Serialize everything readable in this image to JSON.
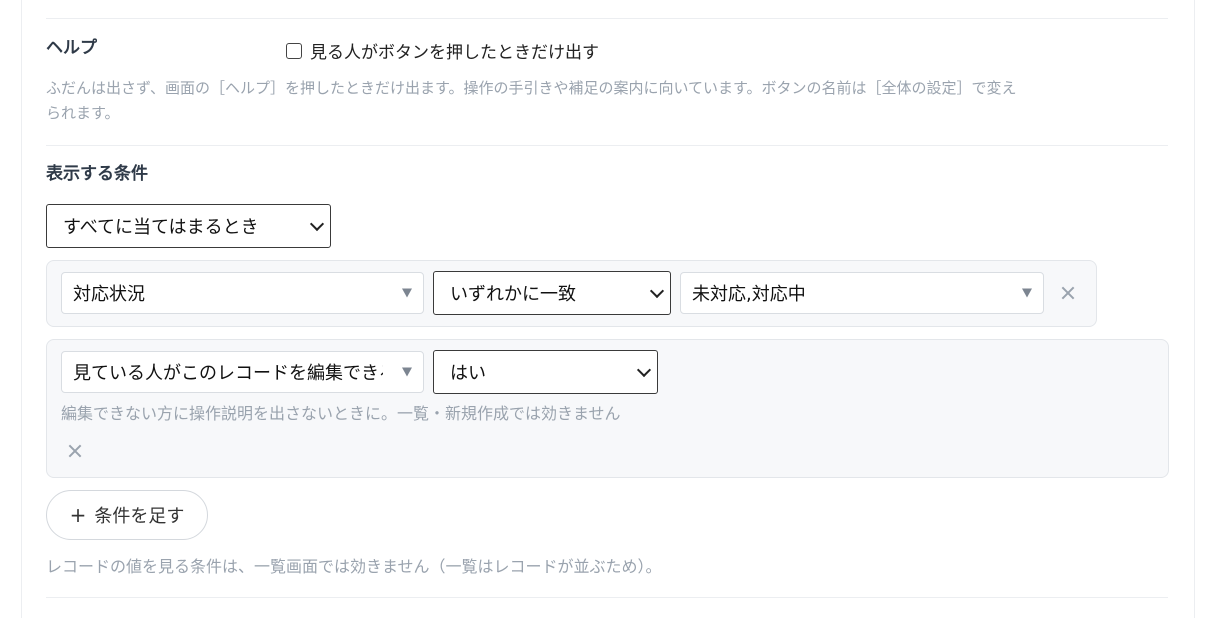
{
  "help": {
    "label": "ヘルプ",
    "checkbox_label": "見る人がボタンを押したときだけ出す",
    "checked": false,
    "description_line1": "ふだんは出さず、画面の［ヘルプ］を押したときだけ出ます。操作の手引きや補足の案内に向いています。ボタンの名前は［全体の設定］で変え",
    "description_line2": "られます。"
  },
  "conditions": {
    "label": "表示する条件",
    "match_mode": "すべてに当てはまるとき",
    "rows": [
      {
        "field": "対応状況",
        "operator": "いずれかに一致",
        "value": "未対応,対応中"
      },
      {
        "field": "見ている人がこのレコードを編集できる",
        "operator": "はい",
        "hint": "編集できない方に操作説明を出さないときに。一覧・新規作成では効きません"
      }
    ],
    "add_button": "条件を足す",
    "footer_note": "レコードの値を見る条件は、一覧画面では効きません（一覧はレコードが並ぶため）。"
  },
  "icons": {
    "remove": "close-icon",
    "add": "plus-icon",
    "dropdown": "caret-down-icon"
  },
  "colors": {
    "muted_text": "#9aa3ae",
    "box_bg": "#f7f8fa",
    "border": "#e3e6ea"
  }
}
